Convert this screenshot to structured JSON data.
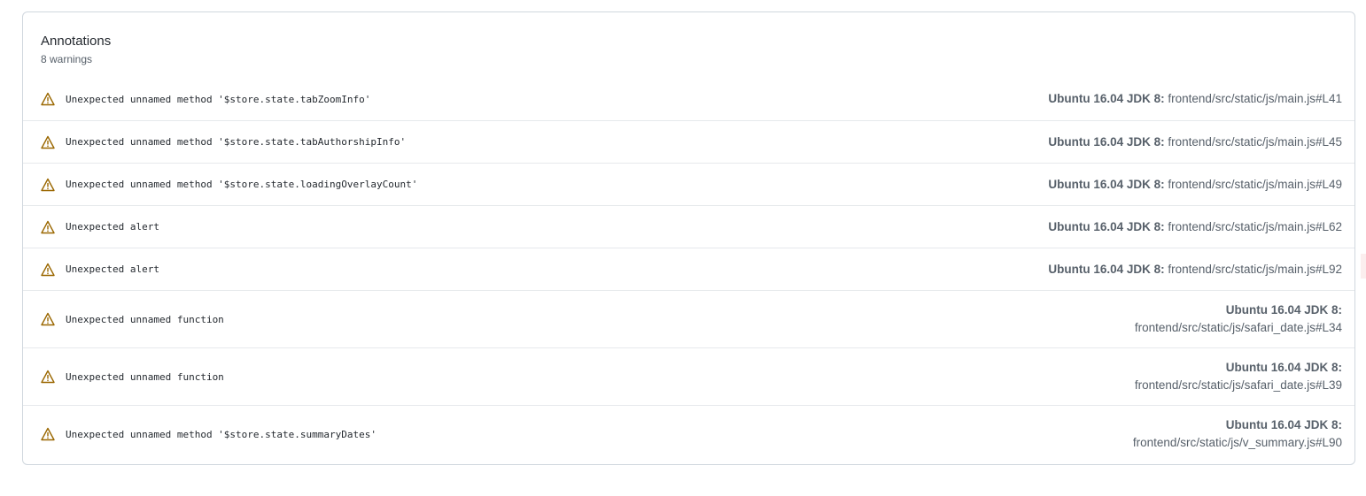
{
  "annotations": {
    "title": "Annotations",
    "subtitle": "8 warnings",
    "items": [
      {
        "message": "Unexpected unnamed method '$store.state.tabZoomInfo'",
        "env": "Ubuntu 16.04 JDK 8:",
        "path": "frontend/src/static/js/main.js#L41"
      },
      {
        "message": "Unexpected unnamed method '$store.state.tabAuthorshipInfo'",
        "env": "Ubuntu 16.04 JDK 8:",
        "path": "frontend/src/static/js/main.js#L45"
      },
      {
        "message": "Unexpected unnamed method '$store.state.loadingOverlayCount'",
        "env": "Ubuntu 16.04 JDK 8:",
        "path": "frontend/src/static/js/main.js#L49"
      },
      {
        "message": "Unexpected alert",
        "env": "Ubuntu 16.04 JDK 8:",
        "path": "frontend/src/static/js/main.js#L62"
      },
      {
        "message": "Unexpected alert",
        "env": "Ubuntu 16.04 JDK 8:",
        "path": "frontend/src/static/js/main.js#L92"
      },
      {
        "message": "Unexpected unnamed function",
        "env": "Ubuntu 16.04 JDK 8:",
        "path": "frontend/src/static/js/safari_date.js#L34"
      },
      {
        "message": "Unexpected unnamed function",
        "env": "Ubuntu 16.04 JDK 8:",
        "path": "frontend/src/static/js/safari_date.js#L39"
      },
      {
        "message": "Unexpected unnamed method '$store.state.summaryDates'",
        "env": "Ubuntu 16.04 JDK 8:",
        "path": "frontend/src/static/js/v_summary.js#L90"
      }
    ]
  },
  "icons": {
    "warning": "alert-triangle-icon"
  },
  "colors": {
    "warning": "#9a6700",
    "border": "#d0d7de",
    "muted": "#57606a"
  }
}
